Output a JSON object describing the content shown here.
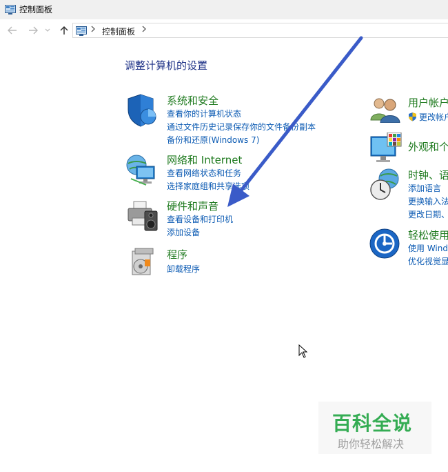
{
  "window": {
    "title": "控制面板"
  },
  "address_bar": {
    "breadcrumb": "控制面板"
  },
  "main": {
    "heading": "调整计算机的设置",
    "categories": [
      {
        "name": "系统和安全",
        "links": [
          "查看你的计算机状态",
          "通过文件历史记录保存你的文件备份副本",
          "备份和还原(Windows 7)"
        ]
      },
      {
        "name": "网络和 Internet",
        "links": [
          "查看网络状态和任务",
          "选择家庭组和共享选项"
        ]
      },
      {
        "name": "硬件和声音",
        "links": [
          "查看设备和打印机",
          "添加设备"
        ]
      },
      {
        "name": "程序",
        "links": [
          "卸载程序"
        ]
      }
    ],
    "right_categories": [
      {
        "name": "用户帐户",
        "links": [
          "更改帐户"
        ]
      },
      {
        "name": "外观和个",
        "links": []
      },
      {
        "name": "时钟、语",
        "links": [
          "添加语言",
          "更换输入法",
          "更改日期、"
        ]
      },
      {
        "name": "轻松使用",
        "links": [
          "使用 Wind",
          "优化视觉显"
        ]
      }
    ]
  },
  "watermark": {
    "title": "百科全说",
    "subtitle": "助你轻松解决"
  },
  "colors": {
    "category": "#1e7a1e",
    "link": "#0c5bb3",
    "heading": "#1e3287",
    "arrow": "#3a5bc8"
  }
}
